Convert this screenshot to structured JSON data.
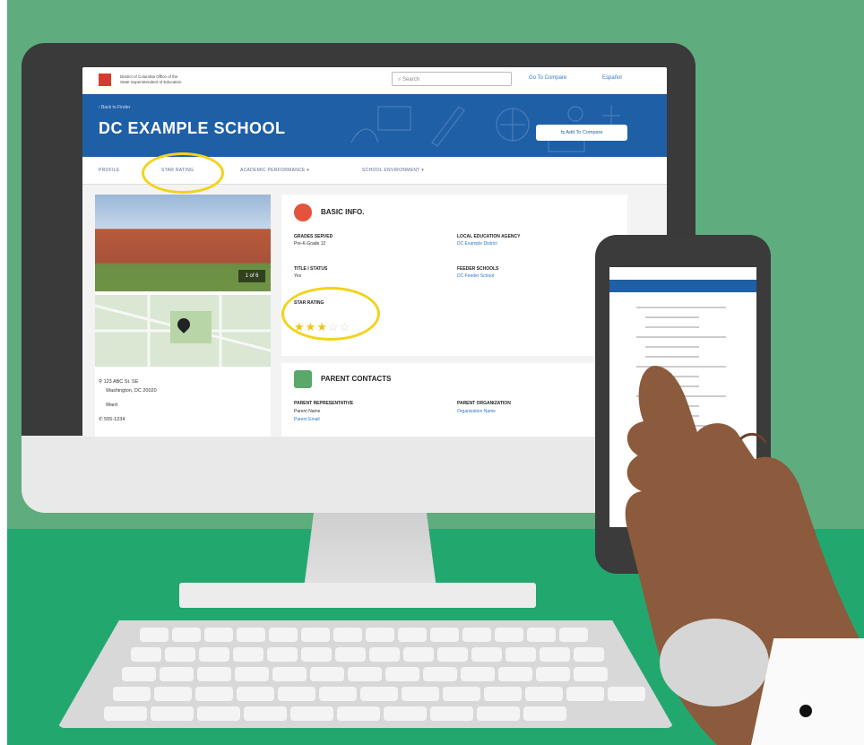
{
  "colors": {
    "wall": "#5fac7e",
    "floor": "#22a86f",
    "banner": "#1f5fa6",
    "accent_link": "#2f78c4",
    "highlight": "#f2d31b",
    "star": "#f2c21b",
    "skin": "#8c5a3c"
  },
  "header": {
    "org_line1": "District of Columbia Office of the",
    "org_line2": "State Superintendent of Education",
    "search_placeholder": "Search",
    "compare_link": "Go To Compare",
    "language_link": "Español"
  },
  "banner": {
    "back_link": "‹ Back to Finder",
    "school_name": "DC EXAMPLE SCHOOL",
    "add_compare_label": "Add To Compare"
  },
  "tabs": [
    {
      "label": "PROFILE"
    },
    {
      "label": "STAR RATING"
    },
    {
      "label": "ACADEMIC PERFORMANCE ▾"
    },
    {
      "label": "SCHOOL ENVIRONMENT ▾"
    }
  ],
  "left_panel": {
    "photo_badge": "1 of 6",
    "address_line1": "123 ABC St. SE",
    "address_line2": "Washington, DC 20020",
    "ward": "Ward",
    "phone": "555-1234"
  },
  "basic_info": {
    "title": "BASIC INFO.",
    "grades_label": "GRADES SERVED",
    "grades_value": "Pre-K-Grade 12",
    "lea_label": "LOCAL EDUCATION AGENCY",
    "lea_value": "DC Example District",
    "title1_label": "TITLE I STATUS",
    "title1_value": "Yes",
    "feeder_label": "FEEDER SCHOOLS",
    "feeder_value": "DC Feeder School",
    "star_label": "STAR RATING",
    "star_rating": 3,
    "star_max": 5
  },
  "parent_contacts": {
    "title": "PARENT CONTACTS",
    "rep_label": "PARENT REPRESENTATIVE",
    "rep_name": "Parent Name",
    "rep_email": "Parent Email",
    "org_label": "PARENT ORGANIZATION",
    "org_name": "Organization Name"
  }
}
